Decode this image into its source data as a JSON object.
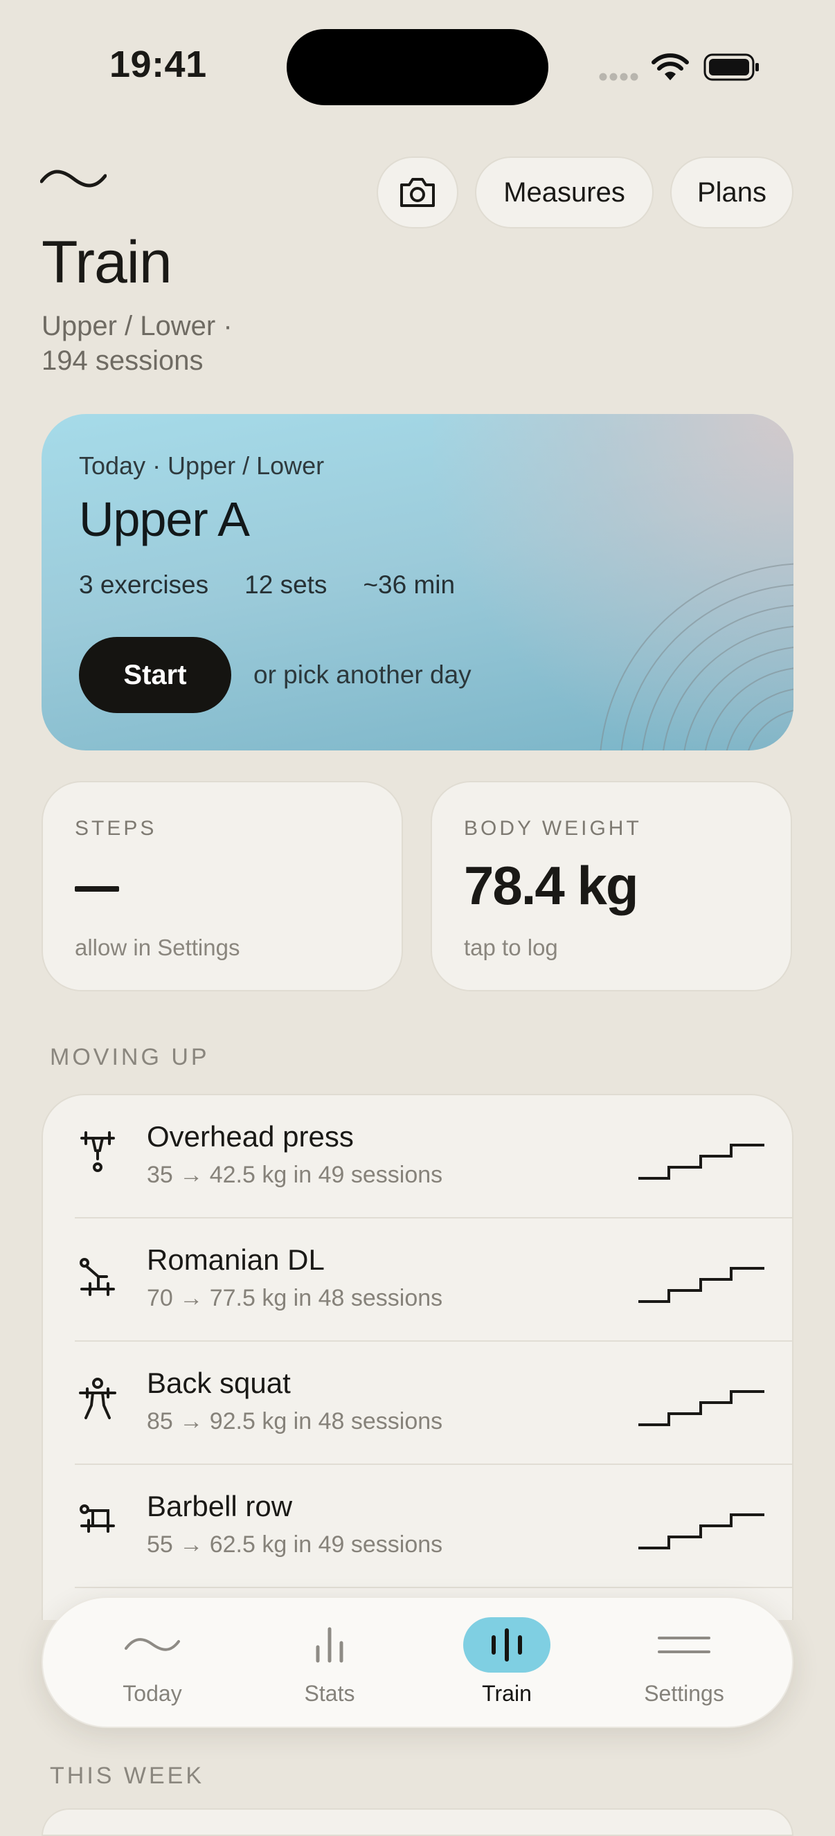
{
  "status_bar": {
    "time": "19:41"
  },
  "header": {
    "logo_icon": "wave-logo-icon",
    "camera_icon": "camera-icon",
    "measures_label": "Measures",
    "plans_label": "Plans",
    "title": "Train",
    "subtitle_line1": "Upper / Lower ·",
    "subtitle_line2": "194 sessions"
  },
  "hero": {
    "kicker": "Today · Upper / Lower",
    "workout_name": "Upper A",
    "exercises": "3 exercises",
    "sets": "12 sets",
    "duration": "~36 min",
    "start_label": "Start",
    "pick_label": "or pick another day"
  },
  "stats": {
    "steps": {
      "label": "STEPS",
      "value": "—",
      "hint": "allow in Settings"
    },
    "weight": {
      "label": "BODY WEIGHT",
      "value": "78.4 kg",
      "hint": "tap to log"
    }
  },
  "moving_up": {
    "label": "MOVING UP",
    "items": [
      {
        "name": "Overhead press",
        "meta": "35 → 42.5 kg in 49 sessions",
        "icon": "overhead-press-icon"
      },
      {
        "name": "Romanian DL",
        "meta": "70 → 77.5 kg in 48 sessions",
        "icon": "romanian-deadlift-icon"
      },
      {
        "name": "Back squat",
        "meta": "85 → 92.5 kg in 48 sessions",
        "icon": "back-squat-icon"
      },
      {
        "name": "Barbell row",
        "meta": "55 → 62.5 kg in 49 sessions",
        "icon": "barbell-row-icon"
      }
    ]
  },
  "tabbar": {
    "tabs": [
      {
        "label": "Today",
        "icon": "wave-icon",
        "active": false
      },
      {
        "label": "Stats",
        "icon": "bars-icon",
        "active": false
      },
      {
        "label": "Train",
        "icon": "train-bars-icon",
        "active": true
      },
      {
        "label": "Settings",
        "icon": "lines-icon",
        "active": false
      }
    ]
  },
  "this_week": {
    "label": "THIS WEEK"
  },
  "colors": {
    "accent": "#7fcfe2",
    "background": "#e9e5dc",
    "card": "#f3f1ec",
    "dark": "#151411"
  }
}
